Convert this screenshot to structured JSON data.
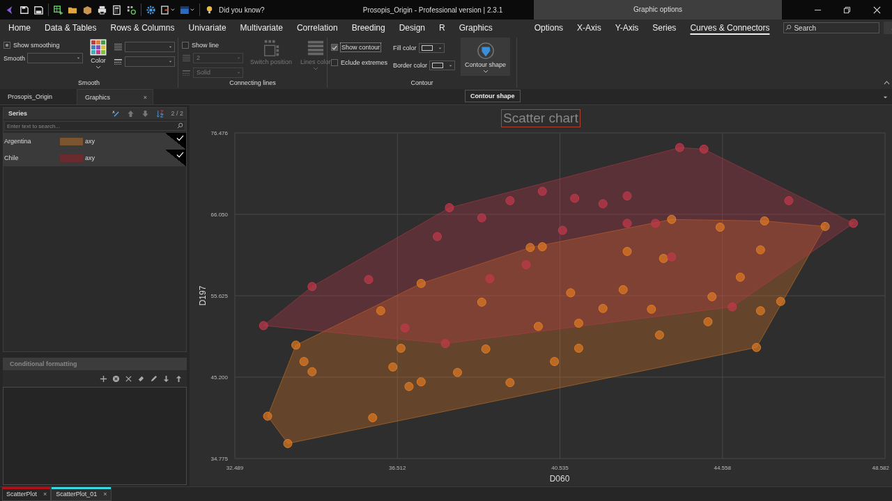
{
  "title_bar": {
    "did_you_know": "Did you know?",
    "title": "Prosopis_Origin - Professional version | 2.3.1",
    "context_title": "Graphic options"
  },
  "menu": {
    "tabs": [
      {
        "label": "Home",
        "selected": false
      },
      {
        "label": "Data & Tables",
        "selected": false
      },
      {
        "label": "Rows & Columns",
        "selected": false
      },
      {
        "label": "Univariate",
        "selected": false
      },
      {
        "label": "Multivariate",
        "selected": false
      },
      {
        "label": "Correlation",
        "selected": false
      },
      {
        "label": "Breeding",
        "selected": false
      },
      {
        "label": "Design",
        "selected": false
      },
      {
        "label": "R",
        "selected": false
      },
      {
        "label": "Graphics",
        "selected": false
      }
    ],
    "context_tabs": [
      {
        "label": "Options",
        "selected": false
      },
      {
        "label": "X-Axis",
        "selected": false
      },
      {
        "label": "Y-Axis",
        "selected": false
      },
      {
        "label": "Series",
        "selected": false
      },
      {
        "label": "Curves & Connectors",
        "selected": true
      }
    ],
    "search": {
      "placeholder": "Search"
    }
  },
  "ribbon": {
    "smooth": {
      "show_smoothing": {
        "label": "Show smoothing",
        "indeterminate": true
      },
      "smooth_label": "Smooth",
      "color_label": "Color",
      "group_label": "Smooth"
    },
    "connecting_lines": {
      "show_line": {
        "label": "Show line",
        "checked": false
      },
      "width": {
        "value": "2",
        "disabled": true
      },
      "style": {
        "value": "Solid",
        "disabled": true
      },
      "switch_position": {
        "label": "Switch position",
        "disabled": true
      },
      "lines_color": {
        "label": "Lines color",
        "disabled": true
      },
      "group_label": "Connecting lines"
    },
    "contour": {
      "show_contour": {
        "label": "Show contour",
        "checked": true
      },
      "exclude_extremes": {
        "label": "Eclude extremes",
        "checked": false
      },
      "fill_color": "Fill color",
      "border_color": "Border color",
      "contour_shape": {
        "label": "Contour shape",
        "hovered": true
      },
      "group_label": "Contour"
    }
  },
  "tooltip": "Contour shape",
  "doc_tabs": [
    {
      "label": "Prosopis_Origin",
      "selected": false
    },
    {
      "label": "Graphics",
      "selected": true,
      "close": "×"
    }
  ],
  "series_panel": {
    "title": "Series",
    "counter": "2 / 2",
    "search_placeholder": "Enter text to search...",
    "items": [
      {
        "name": "Argentina",
        "color": "#7b5530",
        "type": "axy",
        "checked": true
      },
      {
        "name": "Chile",
        "color": "#6b2a2e",
        "type": "axy",
        "checked": true
      }
    ]
  },
  "conditional_formatting": {
    "title": "Conditional formatting"
  },
  "chart": {
    "chart_data": {
      "type": "scatter",
      "title": "Scatter chart",
      "xlabel": "D060",
      "ylabel": "D197",
      "xlim": [
        32.489,
        48.582
      ],
      "ylim": [
        34.775,
        76.476
      ],
      "xticks": [
        {
          "value": 32.489,
          "label": "32.489"
        },
        {
          "value": 36.512,
          "label": "36.512"
        },
        {
          "value": 40.535,
          "label": "40.535"
        },
        {
          "value": 44.558,
          "label": "44.558"
        },
        {
          "value": 48.582,
          "label": "48.582"
        }
      ],
      "yticks": [
        {
          "value": 34.775,
          "label": "34.775"
        },
        {
          "value": 45.2,
          "label": "45.200"
        },
        {
          "value": 55.625,
          "label": "55.625"
        },
        {
          "value": 66.05,
          "label": "66.050"
        },
        {
          "value": 76.476,
          "label": "76.476"
        }
      ],
      "grid": true,
      "series": [
        {
          "color": "#e07b24",
          "x": [
            33.3,
            33.8,
            34.0,
            34.2,
            34.4,
            35.9,
            36.4,
            36.8,
            37.1,
            38.0,
            38.7,
            39.3,
            40.0,
            40.4,
            41.0,
            41.0,
            41.6,
            42.8,
            43.0,
            44.2,
            44.3,
            45.0,
            45.4,
            45.5,
            45.5,
            46.0,
            47.1,
            45.6,
            43.3,
            44.5,
            42.2,
            39.8,
            40.1,
            38.6,
            37.1,
            36.1,
            36.6,
            40.8,
            42.1,
            43.1
          ],
          "values": [
            40.2,
            36.7,
            49.3,
            47.2,
            45.9,
            40.0,
            46.5,
            44.0,
            44.6,
            45.8,
            48.8,
            44.5,
            51.7,
            47.2,
            48.9,
            52.1,
            54.0,
            53.9,
            50.6,
            52.3,
            55.5,
            58.0,
            49.0,
            53.7,
            61.5,
            54.9,
            64.5,
            65.2,
            65.4,
            64.4,
            61.3,
            61.8,
            61.9,
            54.8,
            57.2,
            53.7,
            48.9,
            56.0,
            56.4,
            60.4
          ]
        },
        {
          "color": "#c0394a",
          "x": [
            33.2,
            34.4,
            35.8,
            37.8,
            38.6,
            39.3,
            40.1,
            40.9,
            41.6,
            42.2,
            43.5,
            44.1,
            46.2,
            47.8,
            37.5,
            37.7,
            36.7,
            39.7,
            42.2,
            43.3,
            44.8,
            40.6,
            38.8,
            42.9
          ],
          "values": [
            51.8,
            56.8,
            57.7,
            66.9,
            65.6,
            67.8,
            69.0,
            68.1,
            67.4,
            68.4,
            74.6,
            74.4,
            67.8,
            64.9,
            63.2,
            49.5,
            51.5,
            59.6,
            64.9,
            60.6,
            54.2,
            64.0,
            57.8,
            64.9
          ]
        }
      ]
    }
  },
  "bottom_tabs": [
    {
      "label": "ScatterPlot",
      "selected": false,
      "color": "#b01018",
      "close": "×"
    },
    {
      "label": "ScatterPlot_01",
      "selected": true,
      "color": "#3ad8e0",
      "close": "×"
    }
  ]
}
